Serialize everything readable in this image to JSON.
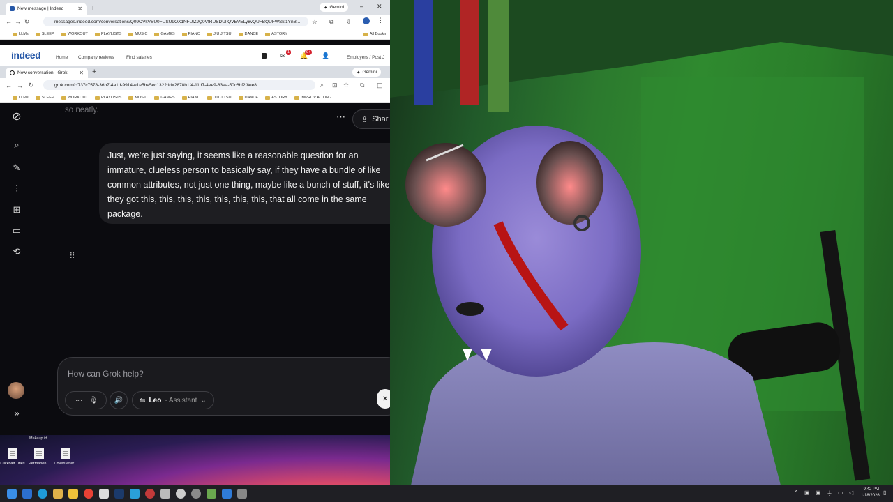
{
  "outer_browser": {
    "tab_title": "New message | Indeed",
    "gemini_label": "Gemini",
    "url": "messages.indeed.com/conversations/Q09OVkVSU0FUSU9OX1NFUlZJQ0VfRUSDUlIQVEVELy8vQUFBQUFWSkl1YnB...",
    "bookmarks": [
      "LLMs",
      "SLEEP",
      "WORKOUT",
      "PLAYLISTS",
      "MUSIC",
      "GAMES",
      "PIANO",
      "JIU JITSU",
      "DANCE",
      "ASTORY"
    ],
    "all_bookmarks": "All Bookm"
  },
  "indeed": {
    "logo": "indeed",
    "nav_home": "Home",
    "nav_reviews": "Company reviews",
    "nav_salaries": "Find salaries",
    "messages_badge": "1",
    "notifications_badge": "9+",
    "employers": "Employers / Post J"
  },
  "inner_browser": {
    "tab_title": "New conversation - Grok",
    "gemini_label": "Gemini",
    "url": "grok.com/c/737c7578-36b7-4a1d-9914-e1e5be5ec132?rid=2878b1f4-11d7-4ee9-83ea-50c6bf2f8ee8",
    "bookmarks": [
      "LLMs",
      "SLEEP",
      "WORKOUT",
      "PLAYLISTS",
      "MUSIC",
      "GAMES",
      "PIANO",
      "JIU JITSU",
      "DANCE",
      "ASTORY",
      "IMPROV ACTING"
    ]
  },
  "grok": {
    "faded_text": "so neatly.",
    "share_label": "Shar",
    "message": "Just, we're just saying, it seems like a reasonable question for an immature, clueless person to basically say, if they have a bundle of like common attributes, not just one thing, maybe like a bunch of stuff, it's like they got this, this, this, this, this, this, this, that all come in the same package.",
    "composer_placeholder": "How can Grok help?",
    "model_name": "Leo",
    "model_mode": "· Assistant"
  },
  "desktop": {
    "makeup_label": "Makeup id",
    "icons": [
      {
        "label": "Clickbait Titles"
      },
      {
        "label": "Permanen..."
      },
      {
        "label": "CoverLetter..."
      }
    ]
  },
  "taskbar": {
    "time": "9:42 PM",
    "date": "1/18/2026"
  },
  "colors": {
    "grok_bg": "#0b0b0f",
    "indeed_blue": "#2557a7",
    "green_screen": "#2f8a2f"
  }
}
